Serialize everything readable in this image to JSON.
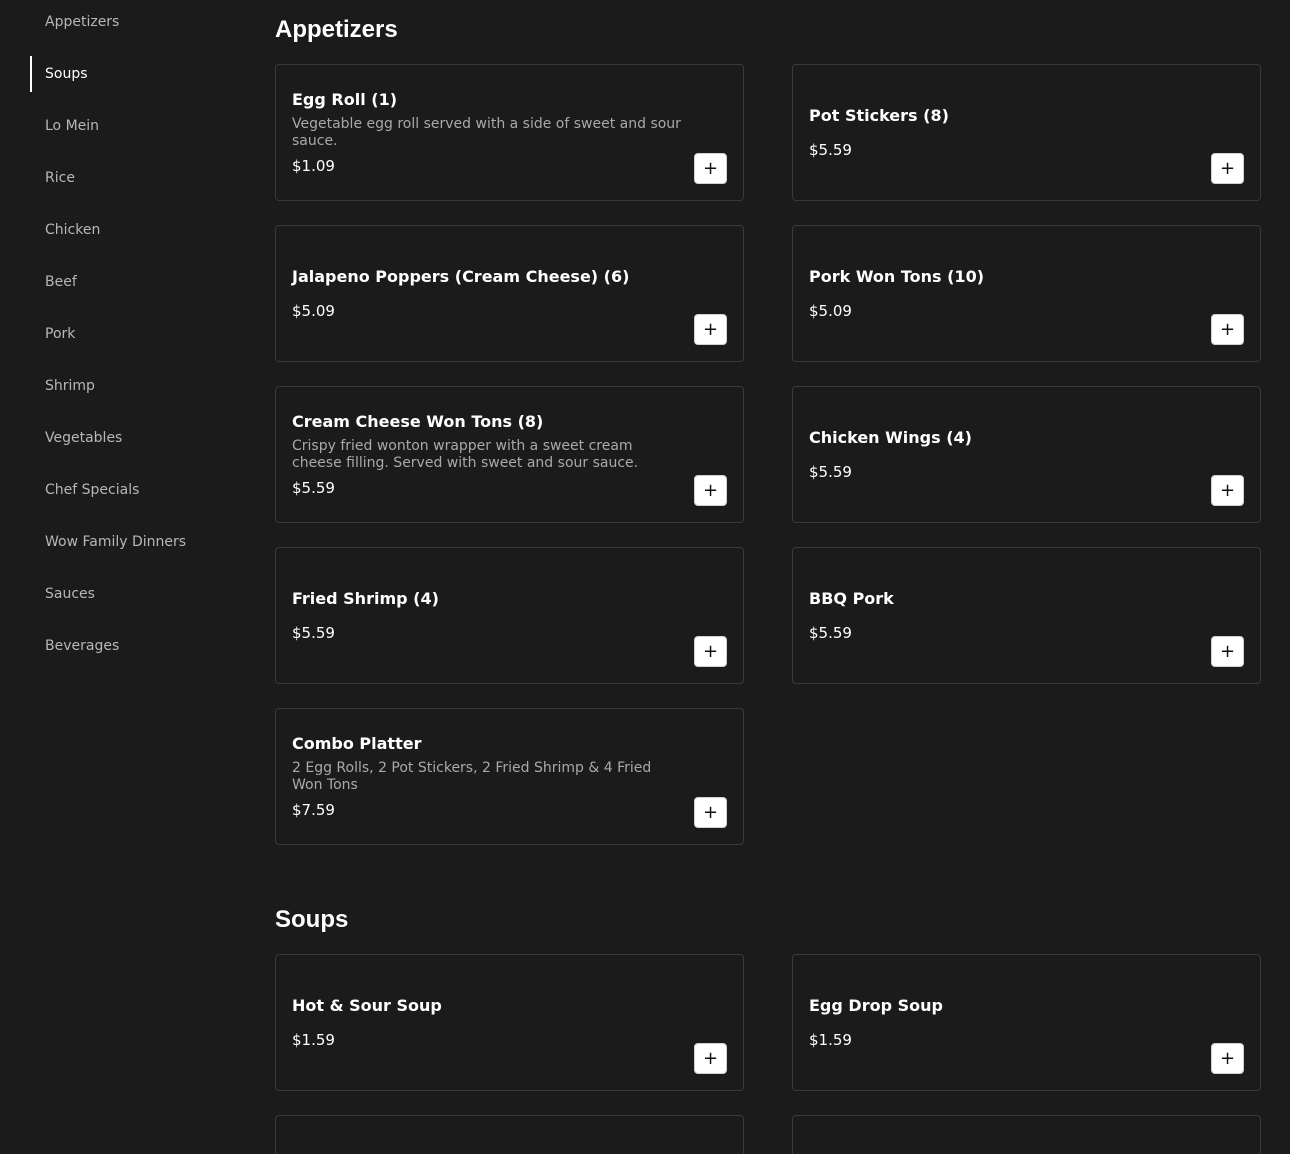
{
  "sidebar": {
    "items": [
      {
        "label": "Appetizers"
      },
      {
        "label": "Soups"
      },
      {
        "label": "Lo Mein"
      },
      {
        "label": "Rice"
      },
      {
        "label": "Chicken"
      },
      {
        "label": "Beef"
      },
      {
        "label": "Pork"
      },
      {
        "label": "Shrimp"
      },
      {
        "label": "Vegetables"
      },
      {
        "label": "Chef Specials"
      },
      {
        "label": "Wow Family Dinners"
      },
      {
        "label": "Sauces"
      },
      {
        "label": "Beverages"
      }
    ],
    "active": "Soups"
  },
  "sections": [
    {
      "title": "Appetizers",
      "items": [
        {
          "name": "Egg Roll (1)",
          "description": "Vegetable egg roll served with a side of sweet and sour sauce.",
          "price": "$1.09"
        },
        {
          "name": "Pot Stickers (8)",
          "description": "",
          "price": "$5.59"
        },
        {
          "name": "Jalapeno Poppers (Cream Cheese) (6)",
          "description": "",
          "price": "$5.09"
        },
        {
          "name": "Pork Won Tons (10)",
          "description": "",
          "price": "$5.09"
        },
        {
          "name": "Cream Cheese Won Tons (8)",
          "description": "Crispy fried wonton wrapper with a sweet cream cheese filling. Served with sweet and sour sauce.",
          "price": "$5.59"
        },
        {
          "name": "Chicken Wings (4)",
          "description": "",
          "price": "$5.59"
        },
        {
          "name": "Fried Shrimp (4)",
          "description": "",
          "price": "$5.59"
        },
        {
          "name": "BBQ Pork",
          "description": "",
          "price": "$5.59"
        },
        {
          "name": "Combo Platter",
          "description": "2 Egg Rolls, 2 Pot Stickers, 2 Fried Shrimp & 4 Fried Won Tons",
          "price": "$7.59"
        }
      ]
    },
    {
      "title": "Soups",
      "items": [
        {
          "name": "Hot & Sour Soup",
          "description": "",
          "price": "$1.59"
        },
        {
          "name": "Egg Drop Soup",
          "description": "",
          "price": "$1.59"
        }
      ]
    }
  ],
  "add_button_label": "+",
  "colors": {
    "background": "#1b1b1b",
    "card_border": "#3a3a3a",
    "text_primary": "#ffffff",
    "text_secondary": "#a9a9a9",
    "button_bg": "#ffffff"
  }
}
